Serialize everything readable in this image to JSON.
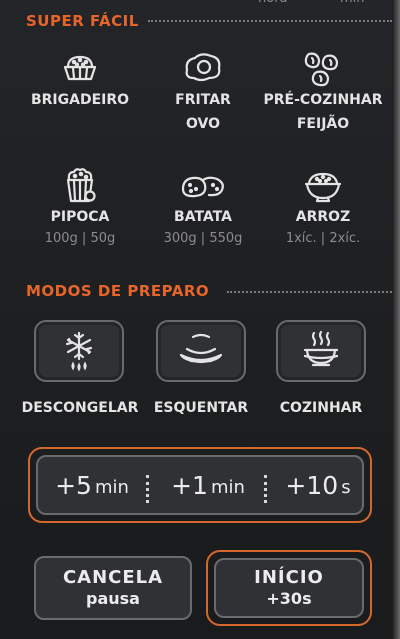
{
  "top_fragments": [
    "hora",
    "min"
  ],
  "super_facil": {
    "title": "SUPER FÁCIL",
    "items": [
      {
        "line1": "BRIGADEIRO",
        "line2": "",
        "sub": "",
        "icon": "brigadeiro-icon"
      },
      {
        "line1": "FRITAR",
        "line2": "OVO",
        "sub": "",
        "icon": "fried-egg-icon"
      },
      {
        "line1": "PRÉ-COZINHAR",
        "line2": "FEIJÃO",
        "sub": "",
        "icon": "beans-icon"
      },
      {
        "line1": "PIPOCA",
        "line2": "",
        "sub": "100g | 50g",
        "icon": "popcorn-icon"
      },
      {
        "line1": "BATATA",
        "line2": "",
        "sub": "300g | 550g",
        "icon": "potato-icon"
      },
      {
        "line1": "ARROZ",
        "line2": "",
        "sub": "1xíc. | 2xíc.",
        "icon": "rice-bowl-icon"
      }
    ]
  },
  "modos": {
    "title": "MODOS DE PREPARO",
    "buttons": [
      {
        "label": "DESCONGELAR",
        "icon": "defrost-snowflake-icon"
      },
      {
        "label": "ESQUENTAR",
        "icon": "heating-plate-icon"
      },
      {
        "label": "COZINHAR",
        "icon": "cooking-pot-icon"
      }
    ]
  },
  "time_buttons": [
    {
      "value": "+5",
      "unit": "min"
    },
    {
      "value": "+1",
      "unit": "min"
    },
    {
      "value": "+10",
      "unit": "s"
    }
  ],
  "actions": {
    "cancel": {
      "main": "CANCELA",
      "sub": "pausa"
    },
    "start": {
      "main": "INÍCIO",
      "sub": "+30s"
    }
  },
  "colors": {
    "accent": "#e8652a",
    "panel": "#1d1f21",
    "button": "#2f3134",
    "text": "#e4e4e4",
    "subtext": "#8c8c8c"
  }
}
